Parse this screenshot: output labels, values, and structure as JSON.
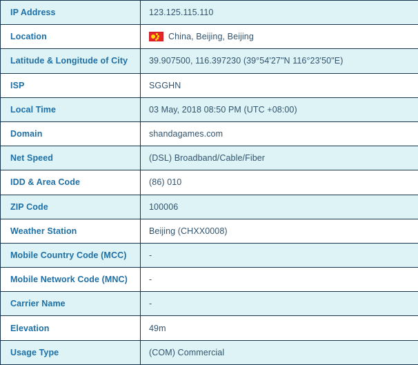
{
  "table": {
    "rows": [
      {
        "label": "IP Address",
        "value": "123.125.115.110",
        "icon": null
      },
      {
        "label": "Location",
        "value": "China, Beijing, Beijing",
        "icon": "china-flag-icon"
      },
      {
        "label": "Latitude & Longitude of City",
        "value": "39.907500, 116.397230 (39°54'27\"N   116°23'50\"E)",
        "icon": null
      },
      {
        "label": "ISP",
        "value": "SGGHN",
        "icon": null
      },
      {
        "label": "Local Time",
        "value": "03 May, 2018 08:50 PM (UTC +08:00)",
        "icon": null
      },
      {
        "label": "Domain",
        "value": "shandagames.com",
        "icon": null
      },
      {
        "label": "Net Speed",
        "value": "(DSL) Broadband/Cable/Fiber",
        "icon": null
      },
      {
        "label": "IDD & Area Code",
        "value": "(86) 010",
        "icon": null
      },
      {
        "label": "ZIP Code",
        "value": "100006",
        "icon": null
      },
      {
        "label": "Weather Station",
        "value": "Beijing (CHXX0008)",
        "icon": null
      },
      {
        "label": "Mobile Country Code (MCC)",
        "value": "-",
        "icon": null
      },
      {
        "label": "Mobile Network Code (MNC)",
        "value": "-",
        "icon": null
      },
      {
        "label": "Carrier Name",
        "value": "-",
        "icon": null
      },
      {
        "label": "Elevation",
        "value": "49m",
        "icon": null
      },
      {
        "label": "Usage Type",
        "value": "(COM) Commercial",
        "icon": null
      }
    ]
  },
  "colors": {
    "label_text": "#1d6fa5",
    "value_text": "#31536d",
    "row_alt_bg": "#ddf3f5",
    "row_bg": "#ffffff",
    "border": "#16334d",
    "flag_red": "#e5252b",
    "flag_yellow": "#ffde00"
  }
}
